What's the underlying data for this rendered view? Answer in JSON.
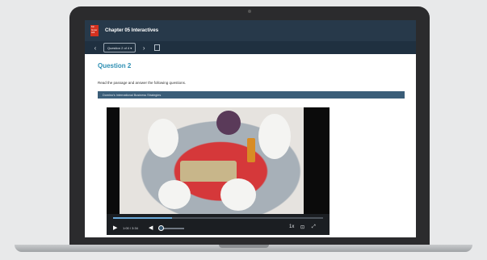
{
  "app": {
    "brand": "Mc Graw Hill",
    "title": "Chapter 05 Interactives"
  },
  "nav": {
    "prev_icon": "chevron-left-icon",
    "next_icon": "chevron-right-icon",
    "question_select": "Question 2 of 4 ▾",
    "bookmark_icon": "bookmark-icon"
  },
  "question": {
    "title": "Question 2",
    "instructions": "Read the passage and answer the following questions.",
    "passage_title": "Domino's International Business Strategies"
  },
  "video": {
    "time": "1:00 / 3:34",
    "progress": 0.28,
    "volume": 0.1,
    "play_icon": "play-icon",
    "volume_icon": "volume-icon",
    "cc_icon": "closed-captions-icon",
    "fullscreen_icon": "fullscreen-icon",
    "speed_icon": "speed-icon"
  },
  "colors": {
    "header_bg": "#27394a",
    "accent": "#2d8fb3",
    "passage_bar": "#3a5d78",
    "logo": "#d3311f"
  }
}
